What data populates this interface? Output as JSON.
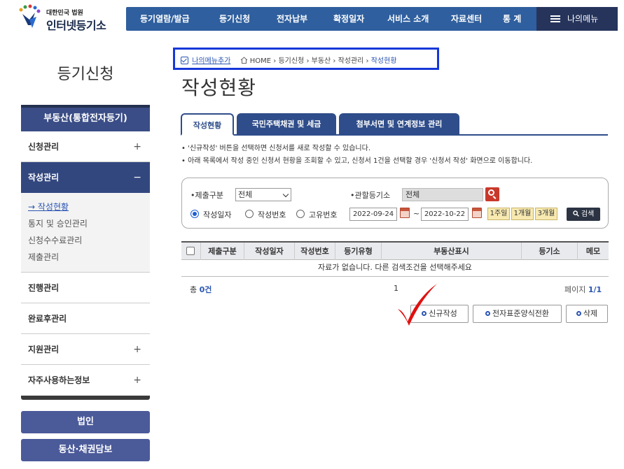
{
  "header": {
    "logo_small": "대한민국 법원",
    "logo_big": "인터넷등기소",
    "nav": [
      "등기열람/발급",
      "등기신청",
      "전자납부",
      "확정일자",
      "서비스 소개",
      "자료센터",
      "통 계"
    ],
    "my_menu": "나의메뉴"
  },
  "sidebar": {
    "title": "등기신청",
    "section": "부동산(통합전자등기)",
    "items": [
      {
        "label": "신청관리",
        "toggle": "+"
      },
      {
        "label": "작성관리",
        "toggle": "−"
      },
      {
        "label": "진행관리",
        "toggle": ""
      },
      {
        "label": "완료후관리",
        "toggle": ""
      },
      {
        "label": "지원관리",
        "toggle": "+"
      },
      {
        "label": "자주사용하는정보",
        "toggle": "+"
      }
    ],
    "sub_items": [
      "작성현황",
      "통지 및 승인관리",
      "신청수수료관리",
      "제출관리"
    ],
    "sub_arrow": "→",
    "buttons": [
      "법인",
      "동산·채권담보"
    ]
  },
  "breadcrumb": {
    "add": "나의메뉴추가",
    "path": "HOME › 등기신청 › 부동산 › 작성관리 › ",
    "current": "작성현황"
  },
  "page_title": "작성현황",
  "tabs": [
    "작성현황",
    "국민주택채권 및 세금",
    "첨부서면 및 연계정보 관리"
  ],
  "notices": [
    "• '신규작성' 버튼을 선택하면 신청서를 새로 작성할 수 있습니다.",
    "• 아래 목록에서 작성 중인 신청서 현황을 조회할 수 있고, 신청서 1건을 선택할 경우 '신청서 작성' 화면으로 이동합니다."
  ],
  "search": {
    "submit_type_label": "•제출구분",
    "submit_type_value": "전체",
    "office_label": "•관할등기소",
    "office_value": "전체",
    "radios": [
      "작성일자",
      "작성번호",
      "고유번호"
    ],
    "date_from": "2022-09-24",
    "tilde": "~",
    "date_to": "2022-10-22",
    "periods": [
      "1주일",
      "1개월",
      "3개월"
    ],
    "search_button": "검색"
  },
  "table": {
    "headers": [
      "제출구분",
      "작성일자",
      "작성번호",
      "등기유형",
      "부동산표시",
      "등기소",
      "메모"
    ],
    "empty_message": "자료가 없습니다. 다른 검색조건을 선택해주세요",
    "total_prefix": "총 ",
    "total_count": "0건",
    "page_number": "1",
    "page_label": "페이지 ",
    "page_value": "1/1"
  },
  "actions": [
    "신규작성",
    "전자표준양식전환",
    "삭제"
  ],
  "colors": {
    "nav_bg": "#2f5f9e",
    "accent": "#2f4d8a",
    "highlight_box": "#1638d8",
    "checkmark": "#e01010"
  }
}
